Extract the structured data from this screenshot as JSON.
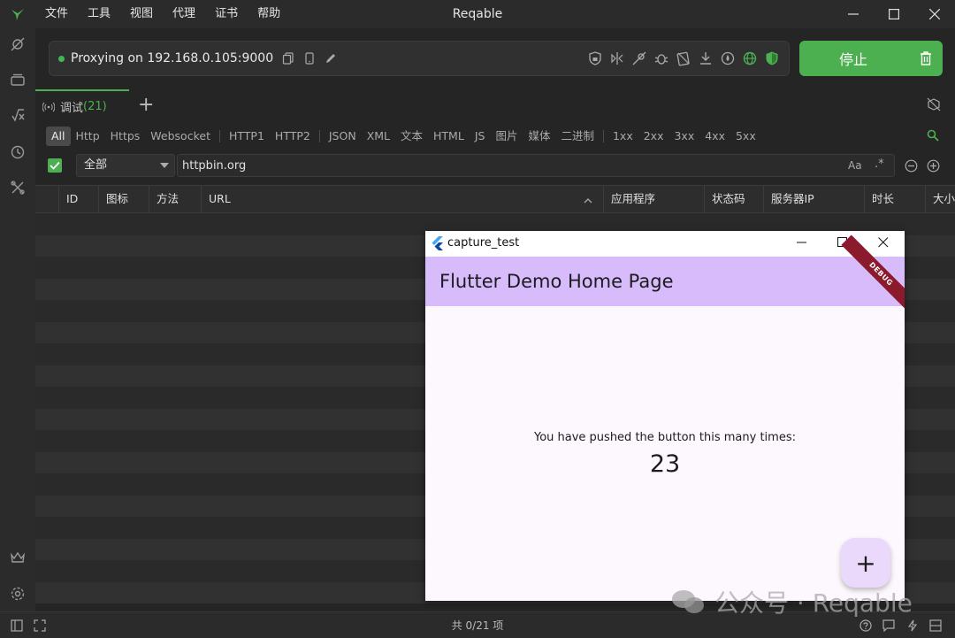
{
  "titlebar": {
    "menu": [
      "文件",
      "工具",
      "视图",
      "代理",
      "证书",
      "帮助"
    ],
    "title": "Reqable"
  },
  "proxy": {
    "status_text": "Proxying on 192.168.0.105:9000",
    "stop_label": "停止"
  },
  "tabs": [
    {
      "label": "调试",
      "count": "(21)"
    }
  ],
  "filters": {
    "group1": [
      "All",
      "Http",
      "Https",
      "Websocket"
    ],
    "group2": [
      "HTTP1",
      "HTTP2"
    ],
    "group3": [
      "JSON",
      "XML",
      "文本",
      "HTML",
      "JS",
      "图片",
      "媒体",
      "二进制"
    ],
    "group4": [
      "1xx",
      "2xx",
      "3xx",
      "4xx",
      "5xx"
    ]
  },
  "search": {
    "scope": "全部",
    "value": "httpbin.org",
    "case_label": "Aa",
    "regex_label": ".*"
  },
  "table": {
    "columns": [
      "ID",
      "图标",
      "方法",
      "URL",
      "应用程序",
      "状态码",
      "服务器IP",
      "时长",
      "大小"
    ]
  },
  "status": {
    "text": "共 0/21 项"
  },
  "flutter_window": {
    "title": "capture_test",
    "appbar_title": "Flutter Demo Home Page",
    "debug_banner": "DEBUG",
    "message": "You have pushed the button this many times:",
    "counter": "23",
    "fab_label": "+"
  },
  "watermark": {
    "text": "公众号 · Reqable"
  },
  "colors": {
    "accent": "#4caf50",
    "appbar": "#d8bbfb",
    "fab": "#ead9fb"
  }
}
